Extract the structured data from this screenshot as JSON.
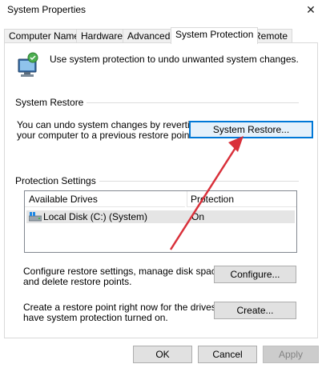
{
  "window": {
    "title": "System Properties",
    "close_glyph": "✕"
  },
  "tabs": [
    {
      "label": "Computer Name",
      "active": false
    },
    {
      "label": "Hardware",
      "active": false
    },
    {
      "label": "Advanced",
      "active": false
    },
    {
      "label": "System Protection",
      "active": true
    },
    {
      "label": "Remote",
      "active": false
    }
  ],
  "intro": {
    "text": "Use system protection to undo unwanted system changes.",
    "icon": "computer-shield-icon"
  },
  "system_restore": {
    "group_label": "System Restore",
    "description_line1": "You can undo system changes by reverting",
    "description_line2": "your computer to a previous restore point.",
    "button_label": "System Restore..."
  },
  "protection": {
    "group_label": "Protection Settings",
    "columns": [
      "Available Drives",
      "Protection"
    ],
    "drives": [
      {
        "name": "Local Disk (C:) (System)",
        "protection": "On",
        "icon": "drive-icon"
      }
    ],
    "configure_text_line1": "Configure restore settings, manage disk space,",
    "configure_text_line2": "and delete restore points.",
    "configure_button": "Configure...",
    "create_text_line1": "Create a restore point right now for the drives that",
    "create_text_line2": "have system protection turned on.",
    "create_button": "Create..."
  },
  "footer": {
    "ok": "OK",
    "cancel": "Cancel",
    "apply": "Apply"
  },
  "colors": {
    "accent": "#0078d7",
    "annotation_arrow": "#d9303a"
  }
}
